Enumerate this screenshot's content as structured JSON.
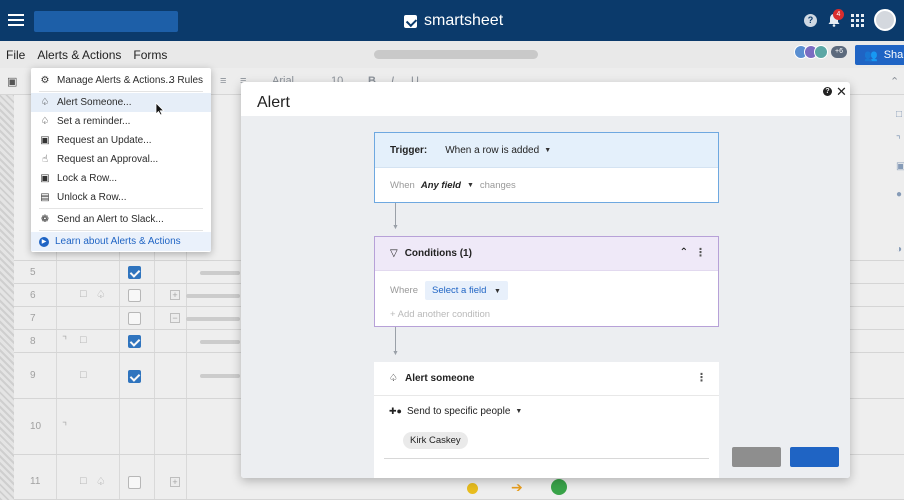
{
  "brand": {
    "name": "smartsheet"
  },
  "topbar": {
    "notification_count": "4",
    "help_glyph": "?"
  },
  "menubar": {
    "items": [
      "File",
      "Alerts & Actions",
      "Forms"
    ],
    "collaborator_more": "+6",
    "share_label": "Share"
  },
  "toolbar": {
    "font_name": "Arial",
    "font_size": "10"
  },
  "alerts_menu": {
    "items": [
      {
        "label": "Manage Alerts & Actions...",
        "icon": "gear-icon",
        "extra": "3 Rules"
      },
      {
        "label": "Alert Someone...",
        "icon": "bell-icon"
      },
      {
        "label": "Set a reminder...",
        "icon": "bell-icon"
      },
      {
        "label": "Request an Update...",
        "icon": "update-request-icon"
      },
      {
        "label": "Request an Approval...",
        "icon": "thumbs-up-icon"
      },
      {
        "label": "Lock a Row...",
        "icon": "lock-icon"
      },
      {
        "label": "Unlock a Row...",
        "icon": "unlock-icon"
      },
      {
        "label": "Send an Alert to Slack...",
        "icon": "slack-icon"
      },
      {
        "label": "Learn about Alerts & Actions",
        "icon": "play-icon"
      }
    ]
  },
  "grid": {
    "rows": [
      {
        "num": "5",
        "checked": true
      },
      {
        "num": "6",
        "checked": false
      },
      {
        "num": "7",
        "checked": false
      },
      {
        "num": "8",
        "checked": true
      },
      {
        "num": "9",
        "checked": true
      },
      {
        "num": "10",
        "checked": false
      },
      {
        "num": "11",
        "checked": false
      }
    ]
  },
  "modal": {
    "title": "Alert",
    "help_glyph": "?",
    "close_glyph": "✕",
    "trigger": {
      "label": "Trigger:",
      "value": "When a row is added",
      "when_prefix": "When",
      "field": "Any field",
      "when_suffix": "changes"
    },
    "conditions": {
      "title": "Conditions (1)",
      "where_label": "Where",
      "select_field": "Select a field",
      "add_condition": "+  Add another condition"
    },
    "action": {
      "title": "Alert someone",
      "send_to": "Send to specific people",
      "recipient": "Kirk Caskey"
    }
  },
  "colors": {
    "topbar": "#0b3a6b",
    "accent": "#1f64c4",
    "trigger_header": "#e4f0fb",
    "conditions_header": "#efe9f8"
  }
}
